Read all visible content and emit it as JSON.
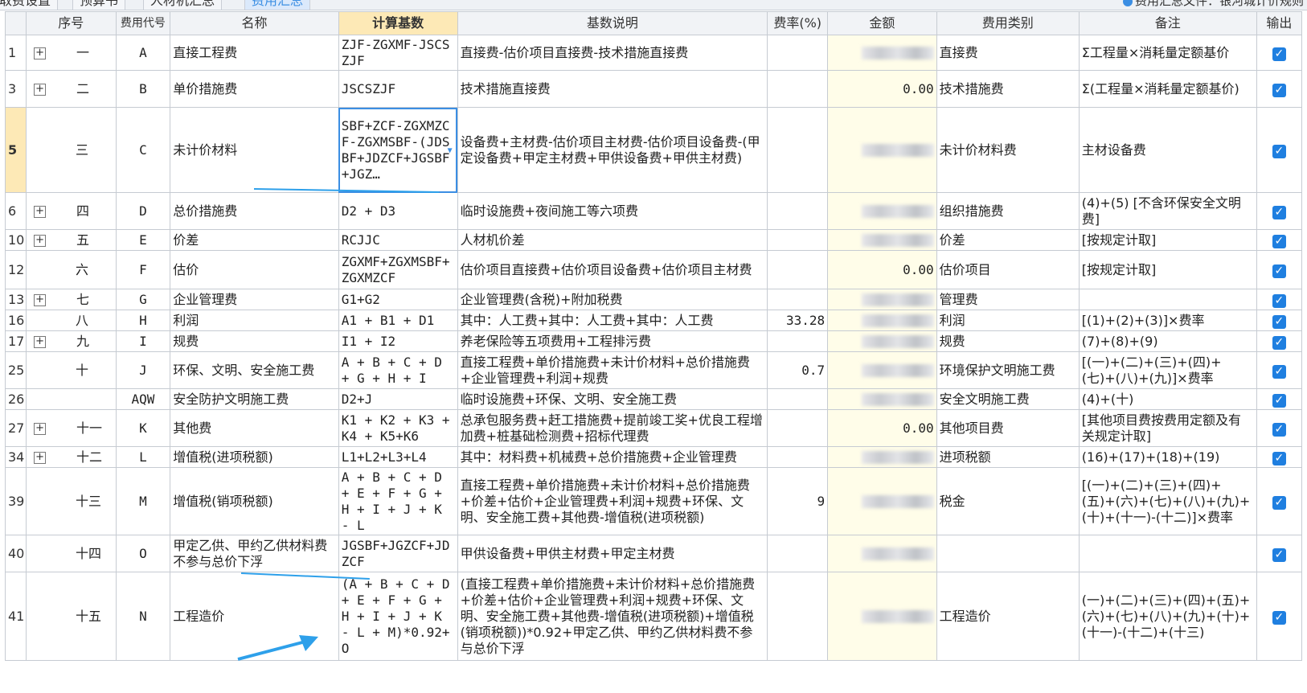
{
  "tabs": [
    "取费设置",
    "预算书",
    "人材机汇总",
    "费用汇总"
  ],
  "active_tab": 3,
  "summary_file": "费用汇总文件：银河城计价规则",
  "columns": [
    "",
    "序号",
    "费用代号",
    "名称",
    "计算基数",
    "基数说明",
    "费率(%)",
    "金额",
    "费用类别",
    "备注",
    "输出"
  ],
  "rows": [
    {
      "row": "1",
      "expand": true,
      "seq": "一",
      "code": "A",
      "name": "直接工程费",
      "basis": "ZJF-ZGXMF-JSCSZJF",
      "desc": "直接费-估价项目直接费-技术措施直接费",
      "rate": "",
      "amount": "",
      "category": "直接费",
      "note": "Σ工程量×消耗量定额基价",
      "output": true
    },
    {
      "row": "3",
      "expand": true,
      "seq": "二",
      "code": "B",
      "name": "单价措施费",
      "basis": "JSCSZJF",
      "desc": "技术措施直接费",
      "rate": "",
      "amount": "0.00",
      "category": "技术措施费",
      "note": "Σ(工程量×消耗量定额基价)",
      "output": true
    },
    {
      "row": "5",
      "expand": false,
      "seq": "三",
      "code": "C",
      "name": "未计价材料",
      "basis": "SBF+ZCF-ZGXMZCF-ZGXMSBF-(JDSBF+JDZCF+JGSBF+JGZ…",
      "desc": "设备费+主材费-估价项目主材费-估价项目设备费-(甲定设备费+甲定主材费+甲供设备费+甲供主材费)",
      "rate": "",
      "amount": "",
      "category": "未计价材料费",
      "note": "主材设备费",
      "output": true
    },
    {
      "row": "6",
      "expand": true,
      "seq": "四",
      "code": "D",
      "name": "总价措施费",
      "basis": "D2 + D3",
      "desc": "临时设施费+夜间施工等六项费",
      "rate": "",
      "amount": "",
      "category": "组织措施费",
      "note": "(4)+(5) [不含环保安全文明费]",
      "output": true
    },
    {
      "row": "10",
      "expand": true,
      "seq": "五",
      "code": "E",
      "name": "价差",
      "basis": "RCJJC",
      "desc": "人材机价差",
      "rate": "",
      "amount": "",
      "category": "价差",
      "note": "[按规定计取]",
      "output": true
    },
    {
      "row": "12",
      "expand": false,
      "seq": "六",
      "code": "F",
      "name": "估价",
      "basis": "ZGXMF+ZGXMSBF+ZGXMZCF",
      "desc": "估价项目直接费+估价项目设备费+估价项目主材费",
      "rate": "",
      "amount": "0.00",
      "category": "估价项目",
      "note": "[按规定计取]",
      "output": true
    },
    {
      "row": "13",
      "expand": true,
      "seq": "七",
      "code": "G",
      "name": "企业管理费",
      "basis": "G1+G2",
      "desc": "企业管理费(含税)+附加税费",
      "rate": "",
      "amount": "",
      "category": "管理费",
      "note": "",
      "output": true
    },
    {
      "row": "16",
      "expand": false,
      "seq": "八",
      "code": "H",
      "name": "利润",
      "basis": "A1 + B1 + D1",
      "desc": "其中：人工费+其中：人工费+其中：人工费",
      "rate": "33.28",
      "amount": "",
      "category": "利润",
      "note": "[(1)+(2)+(3)]×费率",
      "output": true
    },
    {
      "row": "17",
      "expand": true,
      "seq": "九",
      "code": "I",
      "name": "规费",
      "basis": "I1 + I2",
      "desc": "养老保险等五项费用+工程排污费",
      "rate": "",
      "amount": "",
      "category": "规费",
      "note": "(7)+(8)+(9)",
      "output": true
    },
    {
      "row": "25",
      "expand": false,
      "seq": "十",
      "code": "J",
      "name": "环保、文明、安全施工费",
      "basis": "A + B + C + D + G + H + I",
      "desc": "直接工程费+单价措施费+未计价材料+总价措施费+企业管理费+利润+规费",
      "rate": "0.7",
      "amount": "",
      "category": "环境保护文明施工费",
      "note": "[(一)+(二)+(三)+(四)+(七)+(八)+(九)]×费率",
      "output": true
    },
    {
      "row": "26",
      "expand": false,
      "seq": "",
      "code": "AQW",
      "name": "安全防护文明施工费",
      "basis": "D2+J",
      "desc": "临时设施费+环保、文明、安全施工费",
      "rate": "",
      "amount": "",
      "category": "安全文明施工费",
      "note": "(4)+(十)",
      "output": true
    },
    {
      "row": "27",
      "expand": true,
      "seq": "十一",
      "code": "K",
      "name": "其他费",
      "basis": "K1 + K2 + K3 + K4 + K5+K6",
      "desc": "总承包服务费+赶工措施费+提前竣工奖+优良工程增加费+桩基础检测费+招标代理费",
      "rate": "",
      "amount": "0.00",
      "category": "其他项目费",
      "note": "[其他项目费按费用定额及有关规定计取]",
      "output": true
    },
    {
      "row": "34",
      "expand": true,
      "seq": "十二",
      "code": "L",
      "name": "增值税(进项税额)",
      "basis": "L1+L2+L3+L4",
      "desc": "其中：材料费+机械费+总价措施费+企业管理费",
      "rate": "",
      "amount": "",
      "category": "进项税额",
      "note": "(16)+(17)+(18)+(19)",
      "output": true
    },
    {
      "row": "39",
      "expand": false,
      "seq": "十三",
      "code": "M",
      "name": "增值税(销项税额)",
      "basis": "A + B + C + D + E + F + G + H + I + J + K - L",
      "desc": "直接工程费+单价措施费+未计价材料+总价措施费+价差+估价+企业管理费+利润+规费+环保、文明、安全施工费+其他费-增值税(进项税额)",
      "rate": "9",
      "amount": "",
      "category": "税金",
      "note": "[(一)+(二)+(三)+(四)+(五)+(六)+(七)+(八)+(九)+(十)+(十一)-(十二)]×费率",
      "output": true
    },
    {
      "row": "40",
      "expand": false,
      "seq": "十四",
      "code": "O",
      "name": "甲定乙供、甲约乙供材料费不参与总价下浮",
      "basis": "JGSBF+JGZCF+JDZCF",
      "desc": "甲供设备费+甲供主材费+甲定主材费",
      "rate": "",
      "amount": "",
      "category": "",
      "note": "",
      "output": true
    },
    {
      "row": "41",
      "expand": false,
      "seq": "十五",
      "code": "N",
      "name": "工程造价",
      "basis": "(A + B + C + D + E + F + G + H + I + J + K - L + M)*0.92+O",
      "desc": "(直接工程费+单价措施费+未计价材料+总价措施费+价差+估价+企业管理费+利润+规费+环保、文明、安全施工费+其他费-增值税(进项税额)+增值税(销项税额))*0.92+甲定乙供、甲约乙供材料费不参与总价下浮",
      "rate": "",
      "amount": "",
      "category": "工程造价",
      "note": "(一)+(二)+(三)+(四)+(五)+(六)+(七)+(八)+(九)+(十)+(十一)-(十二)+(十三)",
      "output": true
    }
  ],
  "selected_row": 2,
  "icons": {
    "expand": "plus-box-icon",
    "check": "checkbox-checked-icon",
    "dropdown": "dropdown-arrow-icon",
    "arrow": "annotation-arrow-icon"
  }
}
